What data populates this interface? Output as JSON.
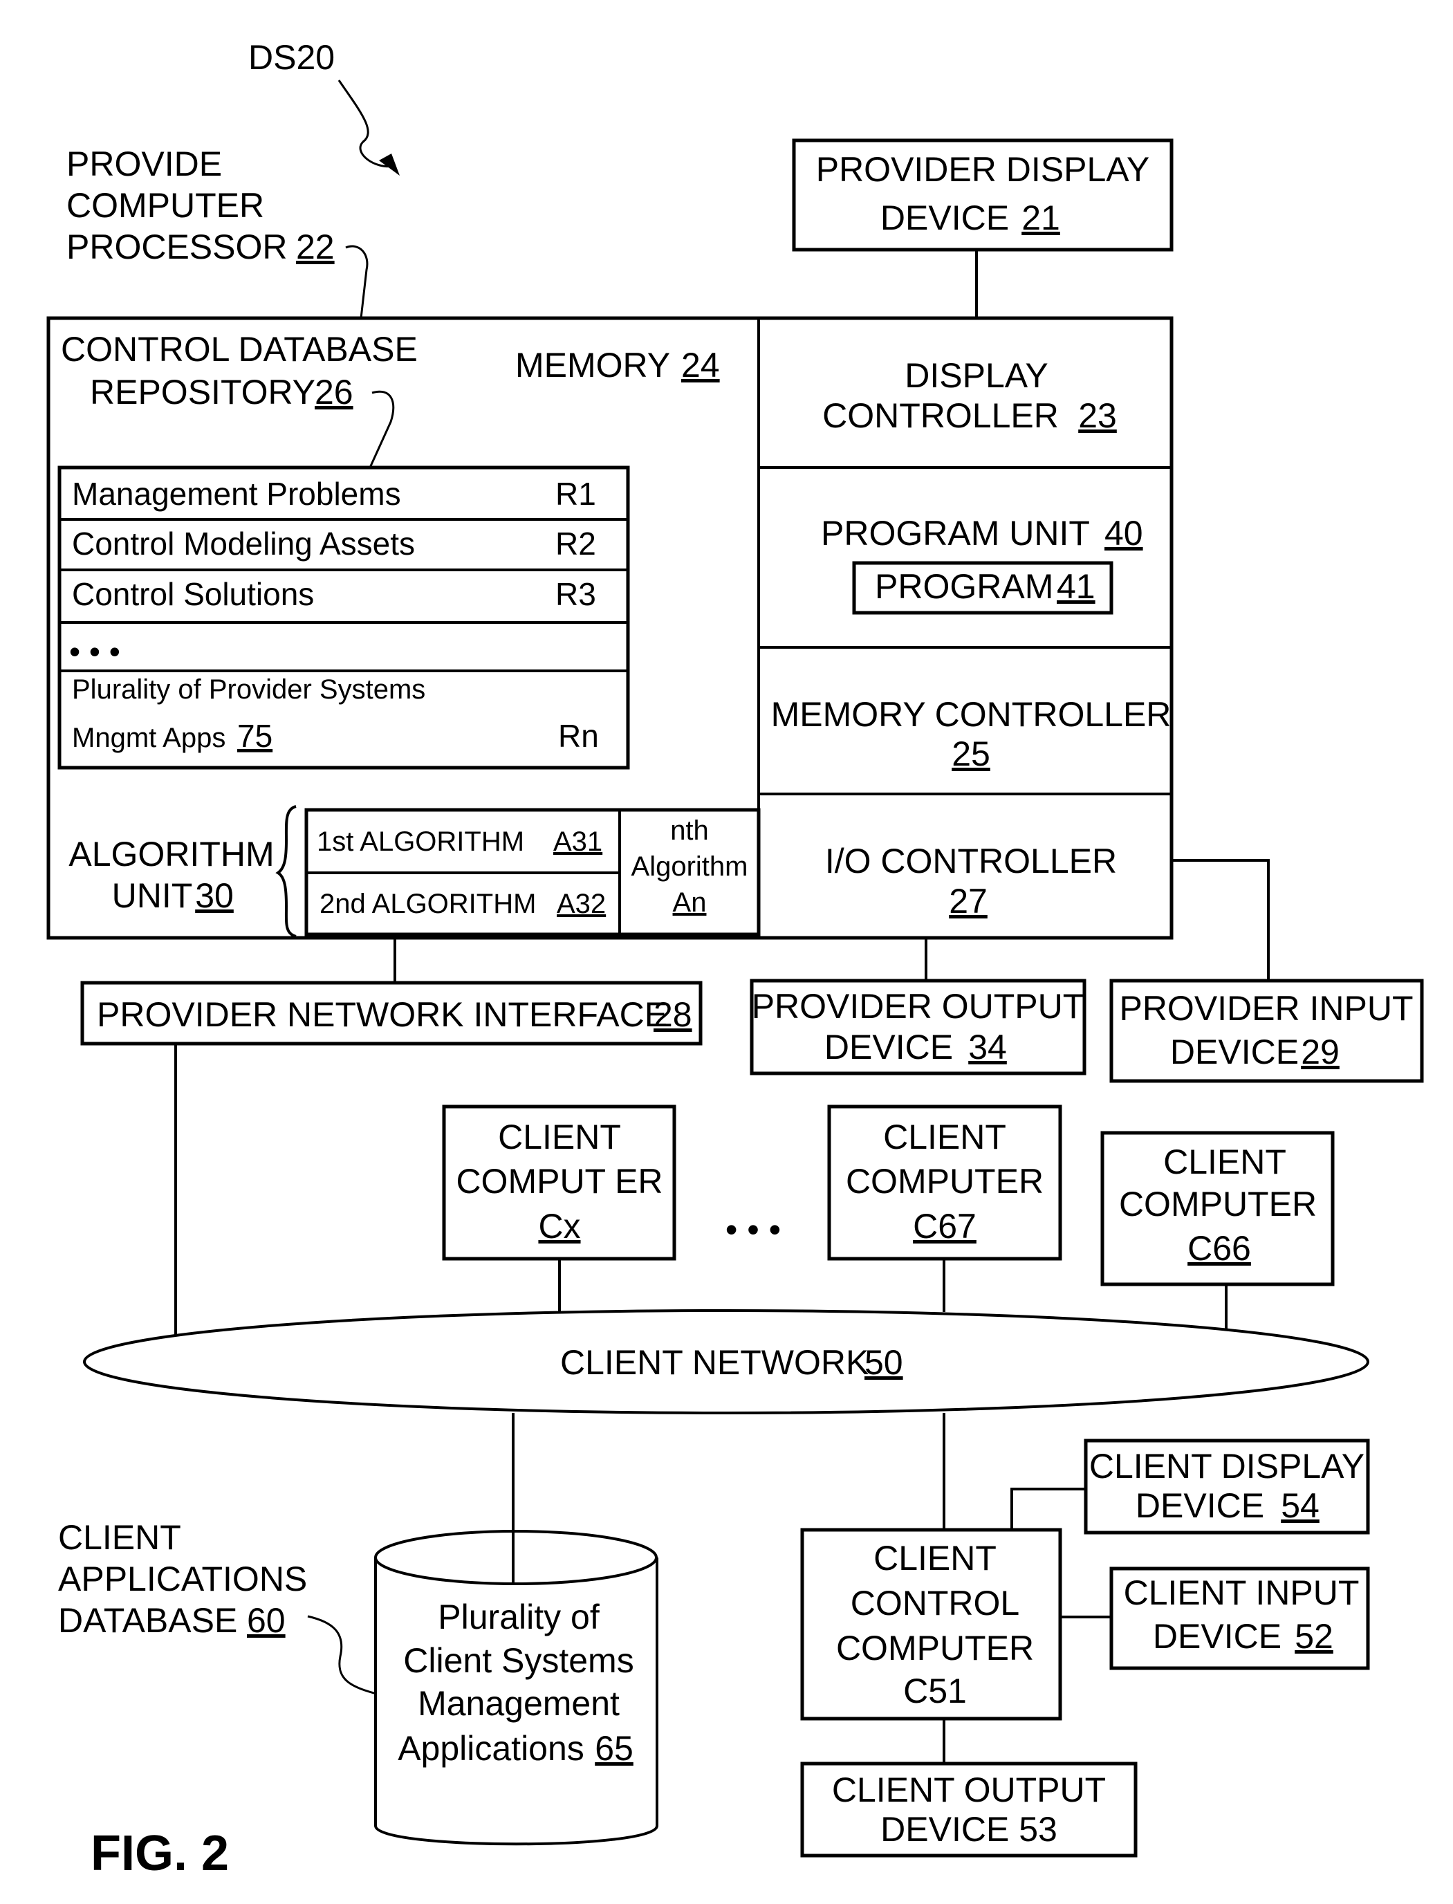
{
  "figure": {
    "title": "FIG. 2",
    "system_ref": "DS20"
  },
  "processor": {
    "label_lines": [
      "PROVIDE",
      "COMPUTER",
      "PROCESSOR"
    ],
    "ref": "22"
  },
  "memory": {
    "label": "MEMORY",
    "ref": "24",
    "repository": {
      "label_lines": [
        "CONTROL DATABASE",
        "REPOSITORY"
      ],
      "ref": "26",
      "rows": [
        {
          "name": "Management Problems",
          "code": "R1"
        },
        {
          "name": "Control Modeling Assets",
          "code": "R2"
        },
        {
          "name": "Control Solutions",
          "code": "R3"
        },
        {
          "name": "• • •",
          "code": ""
        },
        {
          "name_lines": [
            "Plurality of Provider Systems",
            "Mngmt Apps"
          ],
          "name_ref": "75",
          "code": "Rn"
        }
      ]
    },
    "algorithm_unit": {
      "label_lines": [
        "ALGORITHM",
        "UNIT"
      ],
      "ref": "30",
      "algorithms": [
        {
          "label": "1st  ALGORITHM",
          "ref": "A31"
        },
        {
          "label": "2nd ALGORITHM",
          "ref": "A32"
        }
      ],
      "nth": {
        "label_lines": [
          "nth",
          "Algorithm"
        ],
        "ref": "An"
      }
    }
  },
  "right_column": {
    "display_controller": {
      "label_lines": [
        "DISPLAY",
        "CONTROLLER"
      ],
      "ref": "23"
    },
    "program_unit": {
      "label": "PROGRAM  UNIT",
      "ref": "40",
      "program": {
        "label": "PROGRAM",
        "ref": "41"
      }
    },
    "memory_controller": {
      "label": "MEMORY CONTROLLER",
      "ref": "25"
    },
    "io_controller": {
      "label": "I/O CONTROLLER",
      "ref": "27"
    }
  },
  "provider_devices": {
    "display": {
      "label_lines": [
        "PROVIDER DISPLAY",
        "DEVICE"
      ],
      "ref": "21"
    },
    "network_interface": {
      "label": "PROVIDER NETWORK INTERFACE",
      "ref": "28"
    },
    "output": {
      "label_lines": [
        "PROVIDER OUTPUT",
        "DEVICE"
      ],
      "ref": "34"
    },
    "input": {
      "label_lines": [
        "PROVIDER INPUT",
        "DEVICE"
      ],
      "ref": "29"
    }
  },
  "client_computers": [
    {
      "label_lines": [
        "CLIENT",
        "COMPUT ER"
      ],
      "ref": "Cx"
    },
    {
      "label_lines": [
        "CLIENT",
        "COMPUTER"
      ],
      "ref": "C67"
    },
    {
      "label_lines": [
        "CLIENT",
        "COMPUTER"
      ],
      "ref": "C66"
    }
  ],
  "ellipsis": "• • •",
  "client_network": {
    "label": "CLIENT NETWORK",
    "ref": "50"
  },
  "client_database": {
    "label_lines": [
      "CLIENT",
      "APPLICATIONS",
      "DATABASE"
    ],
    "ref": "60",
    "content_lines": [
      "Plurality  of",
      "Client Systems",
      "Management",
      "Applications"
    ],
    "content_ref": "65"
  },
  "client_control": {
    "computer": {
      "label_lines": [
        "CLIENT",
        "CONTROL",
        "COMPUTER",
        "C51"
      ]
    },
    "display": {
      "label_lines": [
        "CLIENT DISPLAY",
        "DEVICE"
      ],
      "ref": "54"
    },
    "input": {
      "label_lines": [
        "CLIENT INPUT",
        "DEVICE"
      ],
      "ref": "52"
    },
    "output": {
      "label_lines": [
        "CLIENT OUTPUT",
        "DEVICE  53"
      ]
    }
  }
}
